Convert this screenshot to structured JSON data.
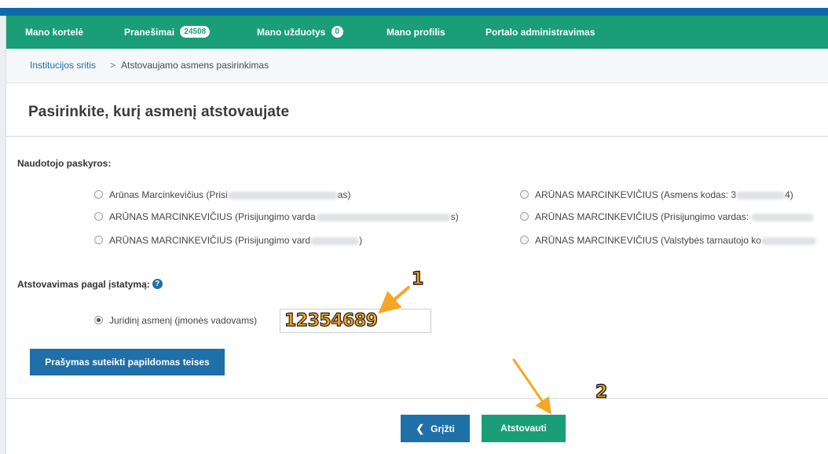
{
  "nav": {
    "items": [
      {
        "label": "Mano kortelė"
      },
      {
        "label": "Pranešimai",
        "badge": "24508"
      },
      {
        "label": "Mano užduotys",
        "badge": "0"
      },
      {
        "label": "Mano profilis"
      },
      {
        "label": "Portalo administravimas"
      }
    ],
    "color": "#1a9e78"
  },
  "breadcrumb": {
    "link": "Institucijos sritis",
    "separator": ">",
    "current": "Atstovaujamo asmens pasirinkimas"
  },
  "page": {
    "title": "Pasirinkite, kurį asmenį atstovaujate"
  },
  "accounts": {
    "label": "Naudotojo paskyros:",
    "left": [
      {
        "pre": "Arūnas Marcinkevičius (Prisi",
        "post": "as)"
      },
      {
        "pre": "ARŪNAS MARCINKEVIČIUS (Prisijungimo varda",
        "post": "s)"
      },
      {
        "pre": "ARŪNAS MARCINKEVIČIUS (Prisijungimo vard",
        "post": ")"
      }
    ],
    "right": [
      {
        "pre": "ARŪNAS MARCINKEVIČIUS (Asmens kodas: 3",
        "post": "4)"
      },
      {
        "pre": "ARŪNAS MARCINKEVIČIUS (Prisijungimo vardas: ",
        "post": ""
      },
      {
        "pre": "ARŪNAS MARCINKEVIČIUS (Valstybės tarnautojo ko",
        "post": ""
      }
    ]
  },
  "representation": {
    "label": "Atstovavimas pagal įstatymą:",
    "option_label": "Juridinį asmenį (įmonės vadovams)",
    "code_value": "12354689"
  },
  "buttons": {
    "request": "Prašymas suteikti papildomas teises",
    "back": "Grįžti",
    "submit": "Atstovauti"
  },
  "annotations": {
    "one": "1",
    "two": "2",
    "color": "#f6a623"
  },
  "colors": {
    "primary_blue": "#1f6fa8",
    "green": "#1a9e78",
    "top_bar": "#0d6aa8"
  }
}
